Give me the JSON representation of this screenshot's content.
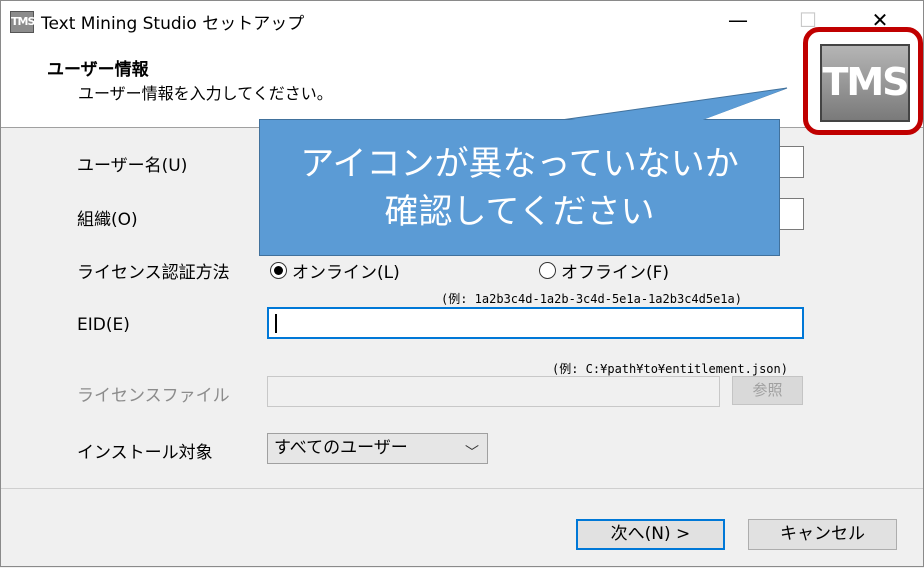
{
  "window": {
    "title": "Text Mining Studio セットアップ",
    "icon_text": "TMS",
    "controls": {
      "minimize": "—",
      "maximize": "☐",
      "close": "✕"
    }
  },
  "header": {
    "title": "ユーザー情報",
    "subtitle": "ユーザー情報を入力してください。",
    "logo_text": "TMS"
  },
  "form": {
    "username_label": "ユーザー名(U)",
    "username_value": "",
    "org_label": "組織(O)",
    "org_value": "",
    "license_method_label": "ライセンス認証方法",
    "radio_online": "オンライン(L)",
    "radio_offline": "オフライン(F)",
    "eid_example": "(例: 1a2b3c4d-1a2b-3c4d-5e1a-1a2b3c4d5e1a)",
    "eid_label": "EID(E)",
    "eid_value": "",
    "file_example": "(例: C:¥path¥to¥entitlement.json)",
    "license_file_label": "ライセンスファイル",
    "license_file_value": "",
    "browse_button": "参照",
    "install_target_label": "インストール対象",
    "install_target_value": "すべてのユーザー"
  },
  "footer": {
    "next_button": "次へ(N) >",
    "cancel_button": "キャンセル"
  },
  "callout": {
    "line1": "アイコンが異なっていないか",
    "line2": "確認してください"
  }
}
